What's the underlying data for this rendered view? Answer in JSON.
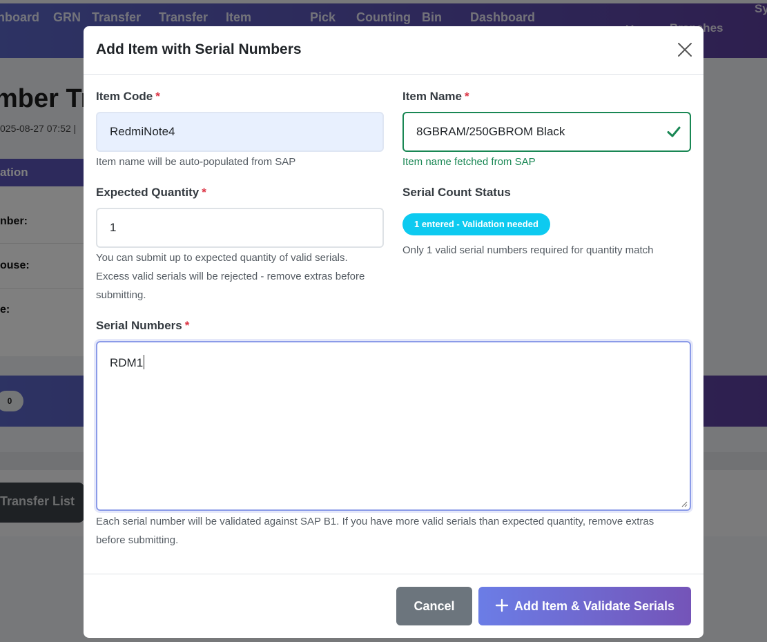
{
  "nav": {
    "items": [
      "hboard",
      "GRN",
      "Transfer",
      "Transfer",
      "Item",
      "Pick",
      "Counting",
      "Bin",
      "Dashboard"
    ],
    "right_items": [
      "Users",
      "Branches",
      "Sy"
    ]
  },
  "background": {
    "page_title": "mber Tr",
    "meta_text": "025-08-27 07:52 |",
    "card_header": "ation",
    "rows": [
      "nber:",
      "ouse:",
      "e:"
    ],
    "badge_count": "0",
    "transfer_button": "Transfer List"
  },
  "modal": {
    "title": "Add Item with Serial Numbers",
    "item_code": {
      "label": "Item Code",
      "required_mark": "*",
      "value": "RedmiNote4",
      "help": "Item name will be auto-populated from SAP"
    },
    "item_name": {
      "label": "Item Name",
      "required_mark": "*",
      "value": "8GBRAM/250GBROM Black",
      "help": "Item name fetched from SAP"
    },
    "expected_quantity": {
      "label": "Expected Quantity",
      "required_mark": "*",
      "value": "1",
      "help_line1": "You can submit up to expected quantity of valid serials.",
      "help_line2": "Excess valid serials will be rejected - remove extras before",
      "help_line3": "submitting."
    },
    "serial_count_status": {
      "label": "Serial Count Status",
      "badge": "1 entered - Validation needed",
      "help": "Only 1 valid serial numbers required for quantity match"
    },
    "serial_numbers": {
      "label": "Serial Numbers",
      "required_mark": "*",
      "value": "RDM1",
      "help_line1": "Each serial number will be validated against SAP B1. If you have more valid serials than expected quantity, remove extras",
      "help_line2": "before submitting."
    },
    "footer": {
      "cancel_label": "Cancel",
      "submit_label": "Add Item & Validate Serials"
    }
  },
  "colors": {
    "accent_gradient_start": "#6b7de6",
    "accent_gradient_end": "#7454b8",
    "status_badge": "#0dcaf0",
    "success": "#198754",
    "required": "#dc3545"
  }
}
